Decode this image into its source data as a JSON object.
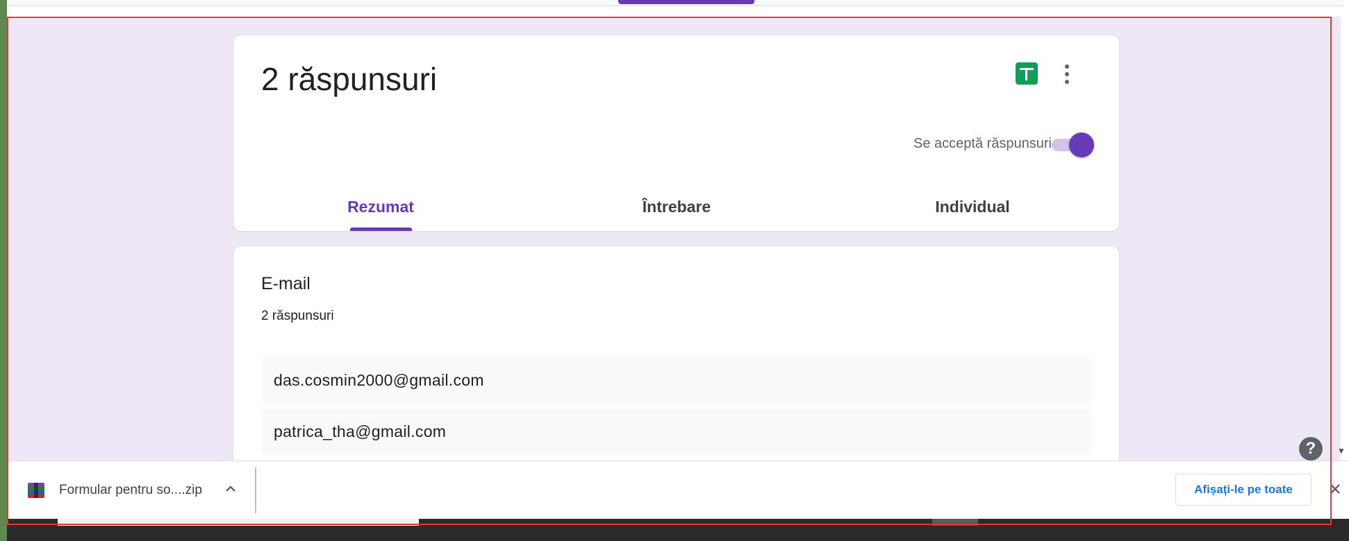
{
  "header": {
    "title": "2 răspunsuri",
    "accepting_label": "Se acceptă răspunsuri",
    "accepting_on": true
  },
  "tabs": [
    {
      "label": "Rezumat",
      "active": true
    },
    {
      "label": "Întrebare",
      "active": false
    },
    {
      "label": "Individual",
      "active": false
    }
  ],
  "question": {
    "title": "E-mail",
    "count_label": "2 răspunsuri",
    "responses": [
      "das.cosmin2000@gmail.com",
      "patrica_tha@gmail.com"
    ]
  },
  "download_shelf": {
    "file_name": "Formular pentru so....zip",
    "show_all_label": "Afișați-le pe toate"
  },
  "help_icon": "?",
  "icons": {
    "sheets": "google-sheets-icon",
    "more": "more-vert-icon",
    "help": "help-icon",
    "archive": "winrar-archive-icon",
    "chevron": "chevron-up-icon",
    "close": "close-icon"
  },
  "colors": {
    "accent": "#673ab7",
    "sheets_green": "#0f9d58",
    "link_blue": "#1a73e8",
    "background": "#ede7f6"
  }
}
